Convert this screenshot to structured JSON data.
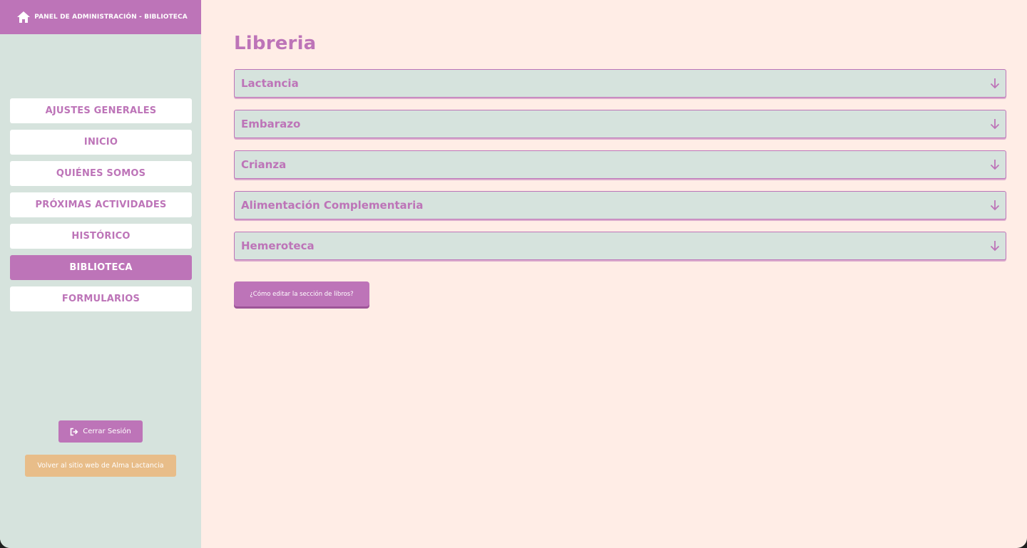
{
  "sidebar": {
    "header_title": "PANEL DE ADMINISTRACIÓN - BIBLIOTECA",
    "header_icon": "home-icon",
    "nav": [
      {
        "label": "AJUSTES GENERALES",
        "active": false
      },
      {
        "label": "INICIO",
        "active": false
      },
      {
        "label": "QUIÉNES SOMOS",
        "active": false
      },
      {
        "label": "PRÓXIMAS ACTIVIDADES",
        "active": false
      },
      {
        "label": "HISTÓRICO",
        "active": false
      },
      {
        "label": "BIBLIOTECA",
        "active": true
      },
      {
        "label": "FORMULARIOS",
        "active": false
      }
    ],
    "logout_label": "Cerrar Sesión",
    "logout_icon": "sign-out-icon",
    "back_label": "Volver al sitio web de Alma Lactancia"
  },
  "main": {
    "title": "Libreria",
    "sections": [
      {
        "label": "Lactancia"
      },
      {
        "label": "Embarazo"
      },
      {
        "label": "Crianza"
      },
      {
        "label": "Alimentación Complementaria"
      },
      {
        "label": "Hemeroteca"
      }
    ],
    "section_icon": "arrow-down-icon",
    "help_button": "¿Cómo editar la sección de libros?"
  },
  "colors": {
    "accent": "#bd74b8",
    "sidebar_bg": "#d6e3dd",
    "main_bg": "#ffede6",
    "secondary_button": "#e8bd89"
  }
}
